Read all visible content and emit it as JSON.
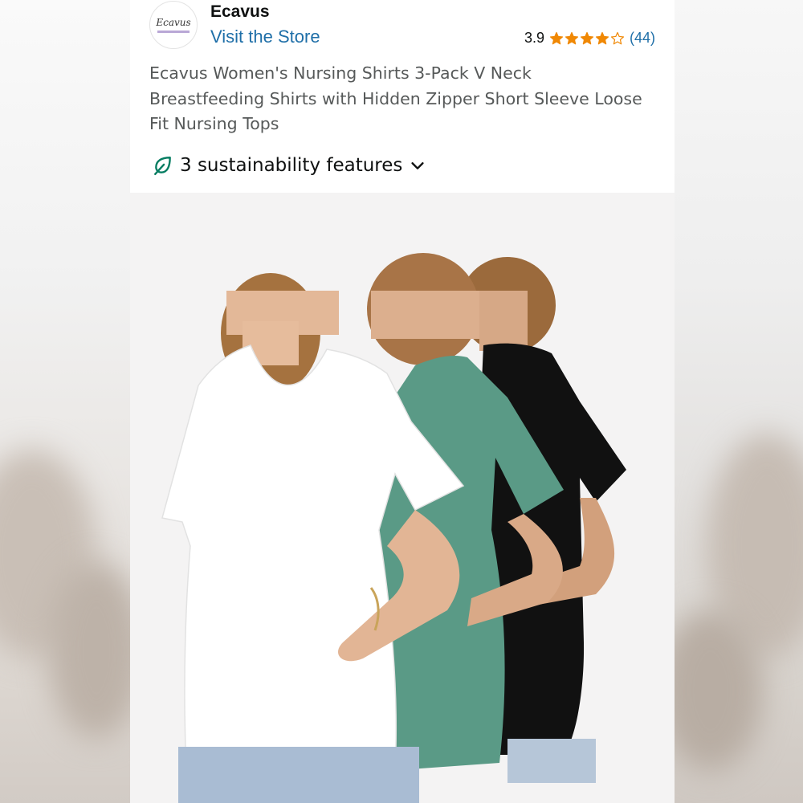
{
  "brand": {
    "logo_text": "Ecavus",
    "name": "Ecavus",
    "store_link": "Visit the Store"
  },
  "rating": {
    "value": "3.9",
    "stars": 3.9,
    "review_count": "(44)",
    "star_color": "#f08804"
  },
  "product": {
    "title": "Ecavus Women's Nursing Shirts 3-Pack V Neck Breastfeeding Shirts with Hidden Zipper Short Sleeve Loose Fit Nursing Tops"
  },
  "sustainability": {
    "label": "3 sustainability features",
    "icon": "leaf-icon",
    "icon_color": "#067d62"
  },
  "colors": {
    "link": "#1f6fa8",
    "text": "#0f1111",
    "muted_text": "#565959",
    "image_background": "#f4f3f3"
  },
  "image": {
    "alt": "product-photo-three-nursing-shirts",
    "shirt_colors": [
      "#ffffff",
      "#5a9a86",
      "#111111"
    ]
  }
}
